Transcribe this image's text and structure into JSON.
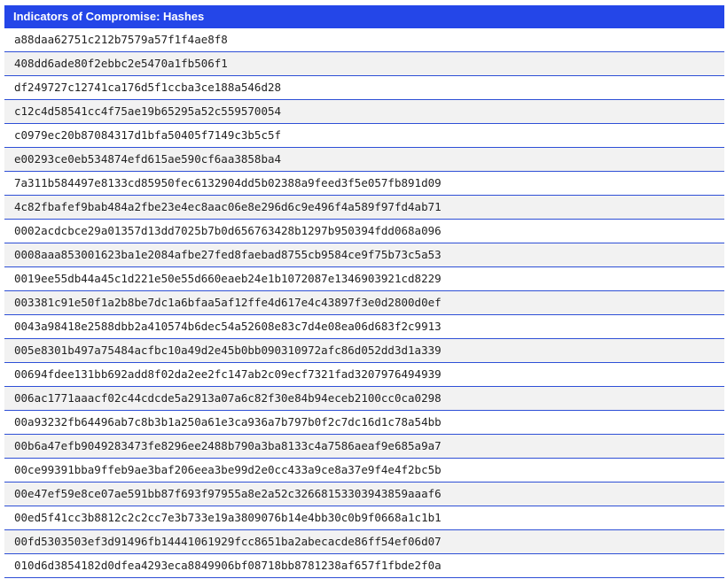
{
  "table": {
    "title": "Indicators of Compromise: Hashes",
    "colors": {
      "header_bg": "#2446e8",
      "header_text": "#ffffff",
      "row_border": "#2e4fd6",
      "row_alt_bg": "#f2f2f2"
    },
    "hashes": [
      "a88daa62751c212b7579a57f1f4ae8f8",
      "408dd6ade80f2ebbc2e5470a1fb506f1",
      "df249727c12741ca176d5f1ccba3ce188a546d28",
      "c12c4d58541cc4f75ae19b65295a52c559570054",
      "c0979ec20b87084317d1bfa50405f7149c3b5c5f",
      "e00293ce0eb534874efd615ae590cf6aa3858ba4",
      "7a311b584497e8133cd85950fec6132904dd5b02388a9feed3f5e057fb891d09",
      "4c82fbafef9bab484a2fbe23e4ec8aac06e8e296d6c9e496f4a589f97fd4ab71",
      "0002acdcbce29a01357d13dd7025b7b0d656763428b1297b950394fdd068a096",
      "0008aaa853001623ba1e2084afbe27fed8faebad8755cb9584ce9f75b73c5a53",
      "0019ee55db44a45c1d221e50e55d660eaeb24e1b1072087e1346903921cd8229",
      "003381c91e50f1a2b8be7dc1a6bfaa5af12ffe4d617e4c43897f3e0d2800d0ef",
      "0043a98418e2588dbb2a410574b6dec54a52608e83c7d4e08ea06d683f2c9913",
      "005e8301b497a75484acfbc10a49d2e45b0bb090310972afc86d052dd3d1a339",
      "00694fdee131bb692add8f02da2ee2fc147ab2c09ecf7321fad3207976494939",
      "006ac1771aaacf02c44cdcde5a2913a07a6c82f30e84b94eceb2100cc0ca0298",
      "00a93232fb64496ab7c8b3b1a250a61e3ca936a7b797b0f2c7dc16d1c78a54bb",
      "00b6a47efb9049283473fe8296ee2488b790a3ba8133c4a7586aeaf9e685a9a7",
      "00ce99391bba9ffeb9ae3baf206eea3be99d2e0cc433a9ce8a37e9f4e4f2bc5b",
      "00e47ef59e8ce07ae591bb87f693f97955a8e2a52c32668153303943859aaaf6",
      "00ed5f41cc3b8812c2c2cc7e3b733e19a3809076b14e4bb30c0b9f0668a1c1b1",
      "00fd5303503ef3d91496fb14441061929fcc8651ba2abecacde86ff54ef06d07",
      "010d6d3854182d0dfea4293eca8849906bf08718bb8781238af657f1fbde2f0a"
    ]
  }
}
